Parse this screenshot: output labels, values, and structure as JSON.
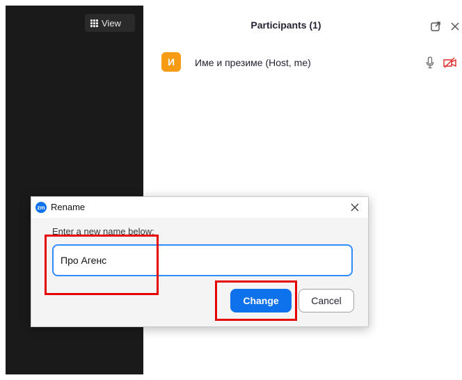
{
  "meeting": {
    "view_button": {
      "label": "View",
      "icon": "grid-icon"
    }
  },
  "participants_panel": {
    "title": "Participants (1)",
    "icons": [
      "popout-icon",
      "close-icon"
    ],
    "participants": [
      {
        "avatar_initial": "И",
        "avatar_color": "#f59b14",
        "name": "Име и презиме (Host, me)",
        "status_icons": [
          "mic-icon",
          "video-off-icon"
        ],
        "video_off_color": "#e02828"
      }
    ]
  },
  "rename_dialog": {
    "logo_text": "zm",
    "title": "Rename",
    "prompt": "Enter a new name below:",
    "input_value": "Про Агенс",
    "buttons": {
      "change": "Change",
      "cancel": "Cancel"
    },
    "accent_color": "#0e72ed"
  }
}
